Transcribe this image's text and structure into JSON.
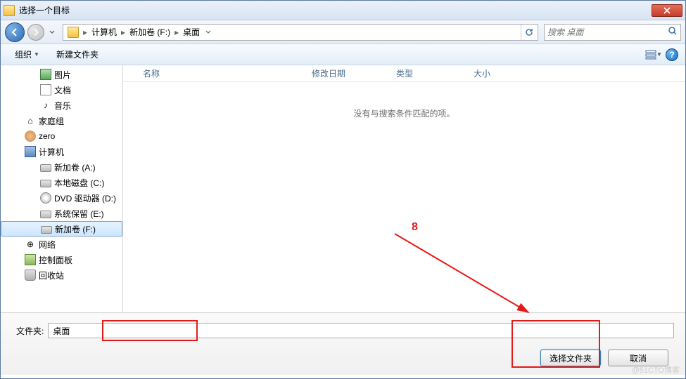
{
  "window": {
    "title": "选择一个目标"
  },
  "nav": {
    "breadcrumb": [
      "计算机",
      "新加卷 (F:)",
      "桌面"
    ],
    "search_placeholder": "搜索 桌面"
  },
  "toolbar": {
    "organize": "组织",
    "new_folder": "新建文件夹"
  },
  "sidebar": {
    "items": [
      {
        "label": "图片",
        "icon": "pic",
        "indent": 2
      },
      {
        "label": "文档",
        "icon": "doc",
        "indent": 2
      },
      {
        "label": "音乐",
        "icon": "music",
        "indent": 2
      },
      {
        "label": "家庭组",
        "icon": "home",
        "indent": 1
      },
      {
        "label": "zero",
        "icon": "user",
        "indent": 1
      },
      {
        "label": "计算机",
        "icon": "comp",
        "indent": 1
      },
      {
        "label": "新加卷 (A:)",
        "icon": "drive",
        "indent": 2
      },
      {
        "label": "本地磁盘 (C:)",
        "icon": "drive",
        "indent": 2
      },
      {
        "label": "DVD 驱动器 (D:)",
        "icon": "dvd",
        "indent": 2
      },
      {
        "label": "系统保留 (E:)",
        "icon": "drive",
        "indent": 2
      },
      {
        "label": "新加卷 (F:)",
        "icon": "drive",
        "indent": 2,
        "selected": true
      },
      {
        "label": "网络",
        "icon": "net",
        "indent": 1
      },
      {
        "label": "控制面板",
        "icon": "panel",
        "indent": 1
      },
      {
        "label": "回收站",
        "icon": "trash",
        "indent": 1
      }
    ]
  },
  "columns": {
    "name": "名称",
    "date": "修改日期",
    "type": "类型",
    "size": "大小"
  },
  "content": {
    "empty_msg": "没有与搜索条件匹配的项。"
  },
  "footer": {
    "folder_label": "文件夹:",
    "folder_value": "桌面",
    "select_btn": "选择文件夹",
    "cancel_btn": "取消"
  },
  "annotation": {
    "label": "8"
  },
  "watermark": "@51CTO博客"
}
